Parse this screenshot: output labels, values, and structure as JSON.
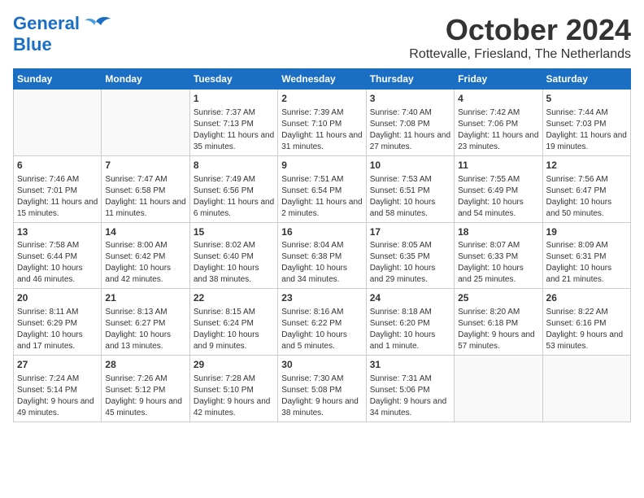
{
  "header": {
    "logo_line1": "General",
    "logo_line2": "Blue",
    "month_title": "October 2024",
    "subtitle": "Rottevalle, Friesland, The Netherlands"
  },
  "weekdays": [
    "Sunday",
    "Monday",
    "Tuesday",
    "Wednesday",
    "Thursday",
    "Friday",
    "Saturday"
  ],
  "weeks": [
    [
      {
        "day": "",
        "empty": true
      },
      {
        "day": "",
        "empty": true
      },
      {
        "day": "1",
        "sunrise": "Sunrise: 7:37 AM",
        "sunset": "Sunset: 7:13 PM",
        "daylight": "Daylight: 11 hours and 35 minutes."
      },
      {
        "day": "2",
        "sunrise": "Sunrise: 7:39 AM",
        "sunset": "Sunset: 7:10 PM",
        "daylight": "Daylight: 11 hours and 31 minutes."
      },
      {
        "day": "3",
        "sunrise": "Sunrise: 7:40 AM",
        "sunset": "Sunset: 7:08 PM",
        "daylight": "Daylight: 11 hours and 27 minutes."
      },
      {
        "day": "4",
        "sunrise": "Sunrise: 7:42 AM",
        "sunset": "Sunset: 7:06 PM",
        "daylight": "Daylight: 11 hours and 23 minutes."
      },
      {
        "day": "5",
        "sunrise": "Sunrise: 7:44 AM",
        "sunset": "Sunset: 7:03 PM",
        "daylight": "Daylight: 11 hours and 19 minutes."
      }
    ],
    [
      {
        "day": "6",
        "sunrise": "Sunrise: 7:46 AM",
        "sunset": "Sunset: 7:01 PM",
        "daylight": "Daylight: 11 hours and 15 minutes."
      },
      {
        "day": "7",
        "sunrise": "Sunrise: 7:47 AM",
        "sunset": "Sunset: 6:58 PM",
        "daylight": "Daylight: 11 hours and 11 minutes."
      },
      {
        "day": "8",
        "sunrise": "Sunrise: 7:49 AM",
        "sunset": "Sunset: 6:56 PM",
        "daylight": "Daylight: 11 hours and 6 minutes."
      },
      {
        "day": "9",
        "sunrise": "Sunrise: 7:51 AM",
        "sunset": "Sunset: 6:54 PM",
        "daylight": "Daylight: 11 hours and 2 minutes."
      },
      {
        "day": "10",
        "sunrise": "Sunrise: 7:53 AM",
        "sunset": "Sunset: 6:51 PM",
        "daylight": "Daylight: 10 hours and 58 minutes."
      },
      {
        "day": "11",
        "sunrise": "Sunrise: 7:55 AM",
        "sunset": "Sunset: 6:49 PM",
        "daylight": "Daylight: 10 hours and 54 minutes."
      },
      {
        "day": "12",
        "sunrise": "Sunrise: 7:56 AM",
        "sunset": "Sunset: 6:47 PM",
        "daylight": "Daylight: 10 hours and 50 minutes."
      }
    ],
    [
      {
        "day": "13",
        "sunrise": "Sunrise: 7:58 AM",
        "sunset": "Sunset: 6:44 PM",
        "daylight": "Daylight: 10 hours and 46 minutes."
      },
      {
        "day": "14",
        "sunrise": "Sunrise: 8:00 AM",
        "sunset": "Sunset: 6:42 PM",
        "daylight": "Daylight: 10 hours and 42 minutes."
      },
      {
        "day": "15",
        "sunrise": "Sunrise: 8:02 AM",
        "sunset": "Sunset: 6:40 PM",
        "daylight": "Daylight: 10 hours and 38 minutes."
      },
      {
        "day": "16",
        "sunrise": "Sunrise: 8:04 AM",
        "sunset": "Sunset: 6:38 PM",
        "daylight": "Daylight: 10 hours and 34 minutes."
      },
      {
        "day": "17",
        "sunrise": "Sunrise: 8:05 AM",
        "sunset": "Sunset: 6:35 PM",
        "daylight": "Daylight: 10 hours and 29 minutes."
      },
      {
        "day": "18",
        "sunrise": "Sunrise: 8:07 AM",
        "sunset": "Sunset: 6:33 PM",
        "daylight": "Daylight: 10 hours and 25 minutes."
      },
      {
        "day": "19",
        "sunrise": "Sunrise: 8:09 AM",
        "sunset": "Sunset: 6:31 PM",
        "daylight": "Daylight: 10 hours and 21 minutes."
      }
    ],
    [
      {
        "day": "20",
        "sunrise": "Sunrise: 8:11 AM",
        "sunset": "Sunset: 6:29 PM",
        "daylight": "Daylight: 10 hours and 17 minutes."
      },
      {
        "day": "21",
        "sunrise": "Sunrise: 8:13 AM",
        "sunset": "Sunset: 6:27 PM",
        "daylight": "Daylight: 10 hours and 13 minutes."
      },
      {
        "day": "22",
        "sunrise": "Sunrise: 8:15 AM",
        "sunset": "Sunset: 6:24 PM",
        "daylight": "Daylight: 10 hours and 9 minutes."
      },
      {
        "day": "23",
        "sunrise": "Sunrise: 8:16 AM",
        "sunset": "Sunset: 6:22 PM",
        "daylight": "Daylight: 10 hours and 5 minutes."
      },
      {
        "day": "24",
        "sunrise": "Sunrise: 8:18 AM",
        "sunset": "Sunset: 6:20 PM",
        "daylight": "Daylight: 10 hours and 1 minute."
      },
      {
        "day": "25",
        "sunrise": "Sunrise: 8:20 AM",
        "sunset": "Sunset: 6:18 PM",
        "daylight": "Daylight: 9 hours and 57 minutes."
      },
      {
        "day": "26",
        "sunrise": "Sunrise: 8:22 AM",
        "sunset": "Sunset: 6:16 PM",
        "daylight": "Daylight: 9 hours and 53 minutes."
      }
    ],
    [
      {
        "day": "27",
        "sunrise": "Sunrise: 7:24 AM",
        "sunset": "Sunset: 5:14 PM",
        "daylight": "Daylight: 9 hours and 49 minutes."
      },
      {
        "day": "28",
        "sunrise": "Sunrise: 7:26 AM",
        "sunset": "Sunset: 5:12 PM",
        "daylight": "Daylight: 9 hours and 45 minutes."
      },
      {
        "day": "29",
        "sunrise": "Sunrise: 7:28 AM",
        "sunset": "Sunset: 5:10 PM",
        "daylight": "Daylight: 9 hours and 42 minutes."
      },
      {
        "day": "30",
        "sunrise": "Sunrise: 7:30 AM",
        "sunset": "Sunset: 5:08 PM",
        "daylight": "Daylight: 9 hours and 38 minutes."
      },
      {
        "day": "31",
        "sunrise": "Sunrise: 7:31 AM",
        "sunset": "Sunset: 5:06 PM",
        "daylight": "Daylight: 9 hours and 34 minutes."
      },
      {
        "day": "",
        "empty": true
      },
      {
        "day": "",
        "empty": true
      }
    ]
  ]
}
